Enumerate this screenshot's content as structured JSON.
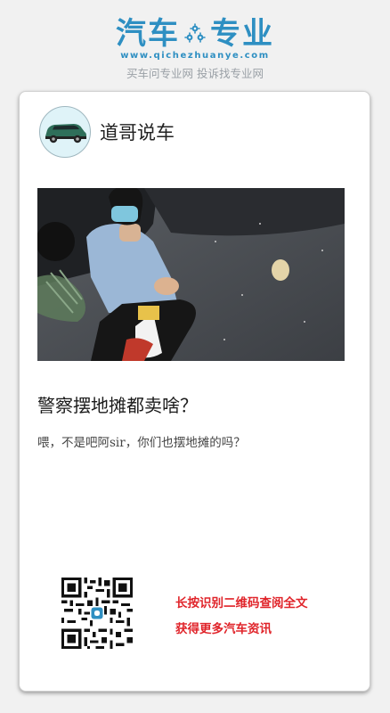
{
  "brand": {
    "logo_left": "汽车",
    "logo_right": "专业",
    "url": "www.qichezhuanye.com",
    "tagline": "买车问专业网 投诉找专业网",
    "color": "#2e8fc2"
  },
  "article": {
    "author": "道哥说车",
    "title": "警察摆地摊都卖啥？",
    "description": "喂，不是吧阿sir，你们也摆地摊的吗？"
  },
  "footer": {
    "cta_line1": "长按识别二维码查阅全文",
    "cta_line2": "获得更多汽车资讯",
    "cta_color": "#e0242a"
  }
}
